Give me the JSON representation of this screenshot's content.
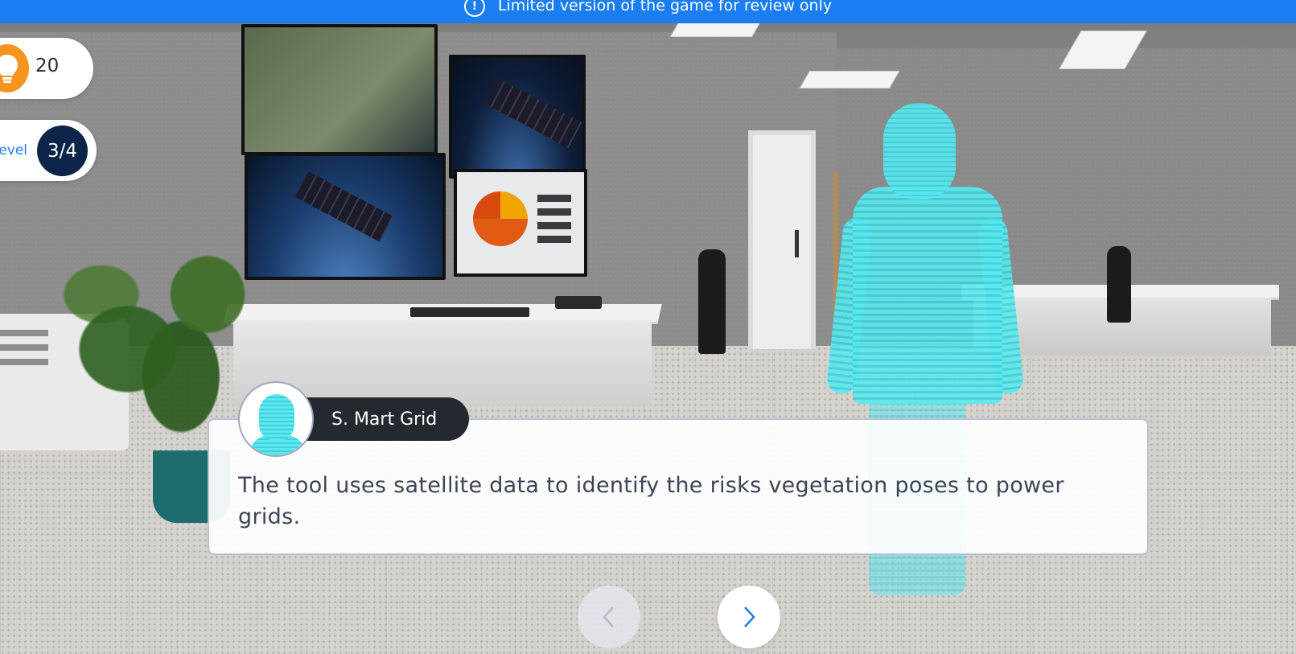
{
  "banner": {
    "text": "Limited version of the game for review only",
    "icon": "info-icon",
    "color": "#1a7ef2"
  },
  "hud": {
    "score": {
      "icon": "lightbulb-icon",
      "value": "20",
      "accent": "#f7941d"
    },
    "level": {
      "label": "Level",
      "value": "3/4",
      "accent": "#0c2447"
    }
  },
  "dialogue": {
    "speaker_name": "S. Mart Grid",
    "text": "The tool uses satellite data to identify the risks vegetation poses to power grids.",
    "avatar": "hologram-avatar"
  },
  "navigation": {
    "prev_icon": "chevron-left-icon",
    "next_icon": "chevron-right-icon"
  }
}
